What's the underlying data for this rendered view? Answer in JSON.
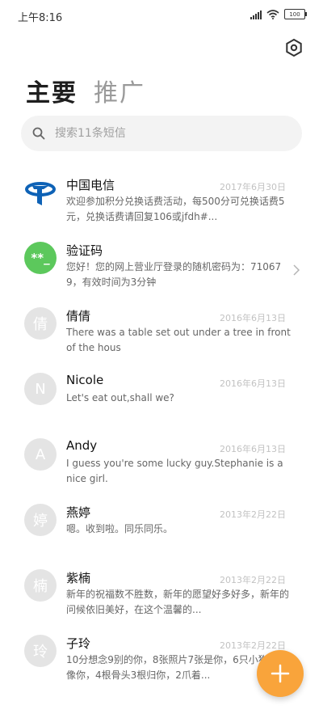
{
  "status": {
    "time": "上午8:16",
    "battery": "100"
  },
  "header": {
    "tab_main": "主要",
    "tab_promo": "推广"
  },
  "search": {
    "placeholder": "搜索11条短信"
  },
  "messages": [
    {
      "avatar": "",
      "name": "中国电信",
      "date": "2017年6月30日",
      "preview": "欢迎参加积分兑换话费活动，每500分可兑换话费5元，兑换话费请回复106或jfdh#..."
    },
    {
      "avatar": "**_",
      "name": "验证码",
      "date": "",
      "preview": "您好！您的网上营业厅登录的随机密码为：710679，有效时间为3分钟"
    },
    {
      "avatar": "倩",
      "name": "倩倩",
      "date": "2016年6月13日",
      "preview": "There was a table set out under a tree in front of the hous"
    },
    {
      "avatar": "N",
      "name": "Nicole",
      "date": "2016年6月13日",
      "preview": "Let's eat out,shall we?"
    },
    {
      "avatar": "A",
      "name": "Andy",
      "date": "2016年6月13日",
      "preview": "I guess you're some lucky guy.Stephanie is a nice girl."
    },
    {
      "avatar": "婷",
      "name": "燕婷",
      "date": "2013年2月22日",
      "preview": "嗯。收到啦。同乐同乐。"
    },
    {
      "avatar": "楠",
      "name": "紫楠",
      "date": "2013年2月22日",
      "preview": "新年的祝福数不胜数，新年的愿望好多好多，新年的问候依旧美好，在这个温馨的..."
    },
    {
      "avatar": "玲",
      "name": "子玲",
      "date": "2013年2月22日",
      "preview": "10分想念9别的你，8张照片7张是你，6只小狗5长像你，4根骨头3根归你，2爪着..."
    }
  ],
  "colors": {
    "fab": "#f9a43b",
    "verify_avatar": "#5cc85c",
    "telecom_blue": "#0e62b6"
  }
}
